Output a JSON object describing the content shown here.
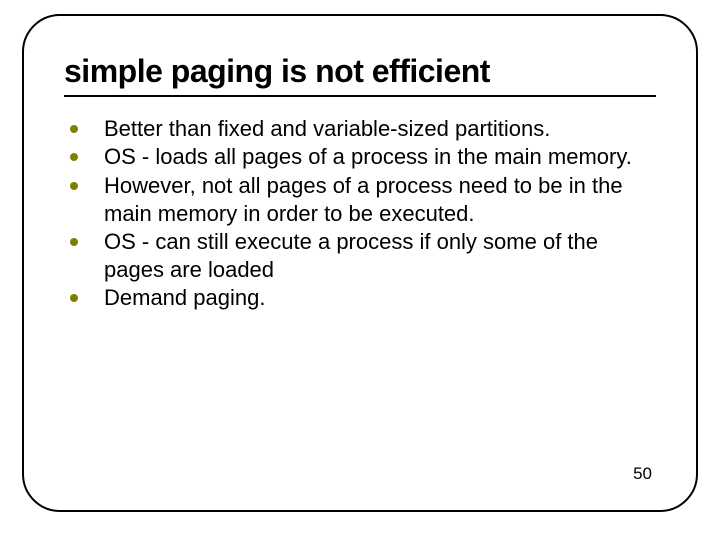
{
  "title": "simple paging is not efficient",
  "bullets": [
    "Better than fixed and variable-sized partitions.",
    "OS - loads all pages of a process in the main memory.",
    "However, not all pages of a process need to be in the main memory in order to be executed.",
    "OS - can still execute a process if only some of the pages are loaded",
    "Demand paging."
  ],
  "page_number": "50"
}
